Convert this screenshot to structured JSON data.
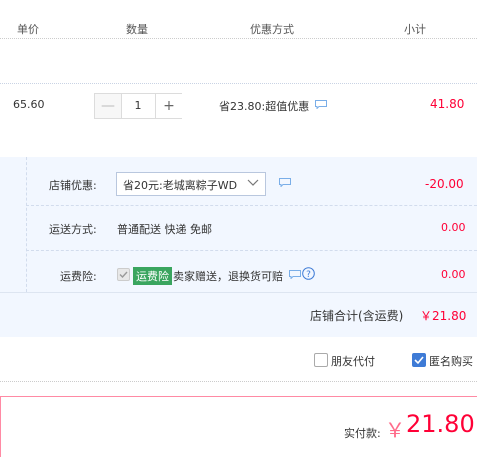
{
  "header": {
    "unit_price_label": "单价",
    "quantity_label": "数量",
    "discount_label": "优惠方式",
    "subtotal_label": "小计"
  },
  "item": {
    "unit_price": "65.60",
    "minus_label": "—",
    "quantity": "1",
    "plus_label": "+",
    "discount_text": "省23.80:超值优惠",
    "subtotal": "41.80"
  },
  "shop": {
    "coupon_label": "店铺优惠:",
    "coupon_selected": "省20元:老城离粽子WD",
    "coupon_amount": "-20.00",
    "shipping_label": "运送方式:",
    "shipping_method": "普通配送 快递 免邮",
    "shipping_amount": "0.00",
    "insurance_label": "运费险:",
    "insurance_badge": "运费险",
    "insurance_text": "卖家赠送，退换货可赔",
    "insurance_amount": "0.00",
    "shop_total_label": "店铺合计(含运费)",
    "shop_total_amount": "￥21.80"
  },
  "options": {
    "friend_pay_label": "朋友代付",
    "anonymous_label": "匿名购买"
  },
  "payment": {
    "actual_label": "实付款:",
    "currency_symbol": "￥",
    "actual_amount": "21.80"
  },
  "colors": {
    "accent_red": "#ff0036",
    "panel_blue": "#f2f7ff",
    "checkbox_blue": "#3e7bd6",
    "badge_green": "#3aa55f"
  }
}
